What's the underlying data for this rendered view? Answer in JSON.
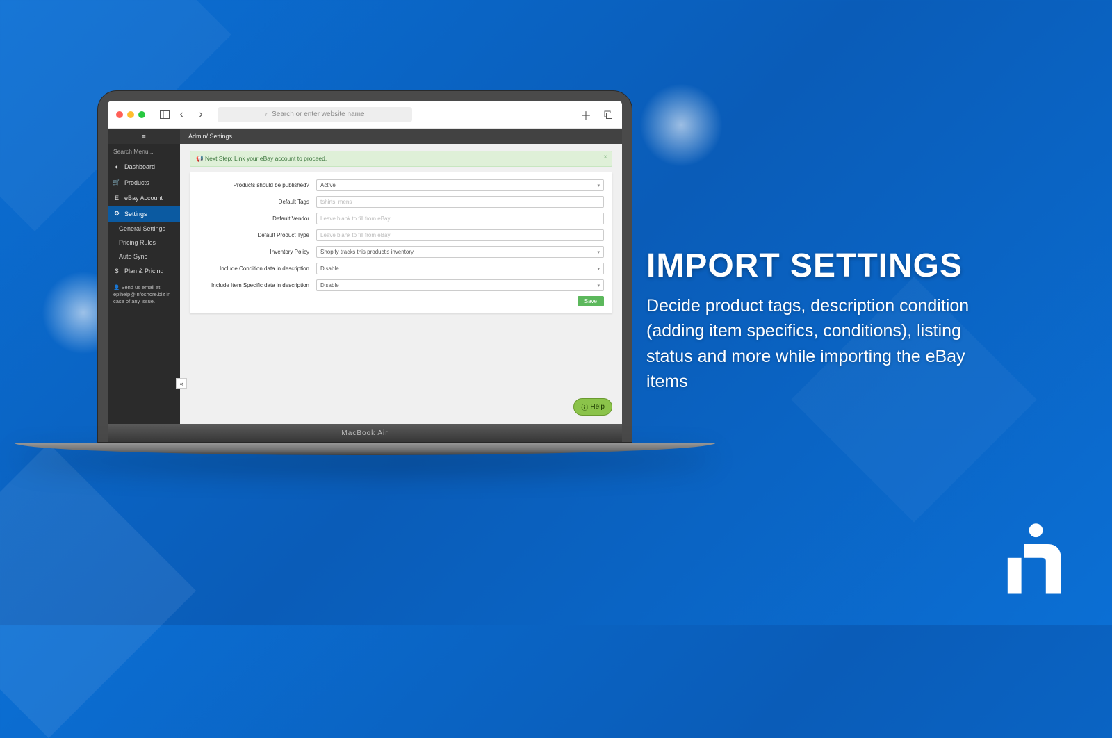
{
  "browser": {
    "address_placeholder": "Search or enter website name"
  },
  "breadcrumb": {
    "root": "Admin",
    "current": "Settings"
  },
  "sidebar": {
    "search_placeholder": "Search Menu...",
    "items": [
      {
        "icon": "◐",
        "label": "Dashboard"
      },
      {
        "icon": "🛒",
        "label": "Products"
      },
      {
        "icon": "E",
        "label": "eBay Account"
      },
      {
        "icon": "⚙",
        "label": "Settings"
      },
      {
        "icon": "$",
        "label": "Plan & Pricing"
      }
    ],
    "sub_items": [
      {
        "label": "General Settings"
      },
      {
        "label": "Pricing Rules"
      },
      {
        "label": "Auto Sync"
      }
    ],
    "footer_text": "Send us email at epihelp@infoshore.biz in case of any issue."
  },
  "alert": {
    "text": "Next Step: Link your eBay account to proceed."
  },
  "form": {
    "rows": [
      {
        "label": "Products should be published?",
        "type": "select",
        "value": "Active"
      },
      {
        "label": "Default Tags",
        "type": "input",
        "placeholder": "tshirts, mens"
      },
      {
        "label": "Default Vendor",
        "type": "input",
        "placeholder": "Leave blank to fill from eBay"
      },
      {
        "label": "Default Product Type",
        "type": "input",
        "placeholder": "Leave blank to fill from eBay"
      },
      {
        "label": "Inventory Policy",
        "type": "select",
        "value": "Shopify tracks this product's inventory"
      },
      {
        "label": "Include Condition data in description",
        "type": "select",
        "value": "Disable"
      },
      {
        "label": "Include Item Specific data in description",
        "type": "select",
        "value": "Disable"
      }
    ],
    "save_label": "Save"
  },
  "help_label": "Help",
  "hinge_label": "MacBook Air",
  "marketing": {
    "heading": "IMPORT SETTINGS",
    "body": "Decide product tags, description condition (adding item specifics, conditions), listing status and more while importing the eBay items"
  }
}
